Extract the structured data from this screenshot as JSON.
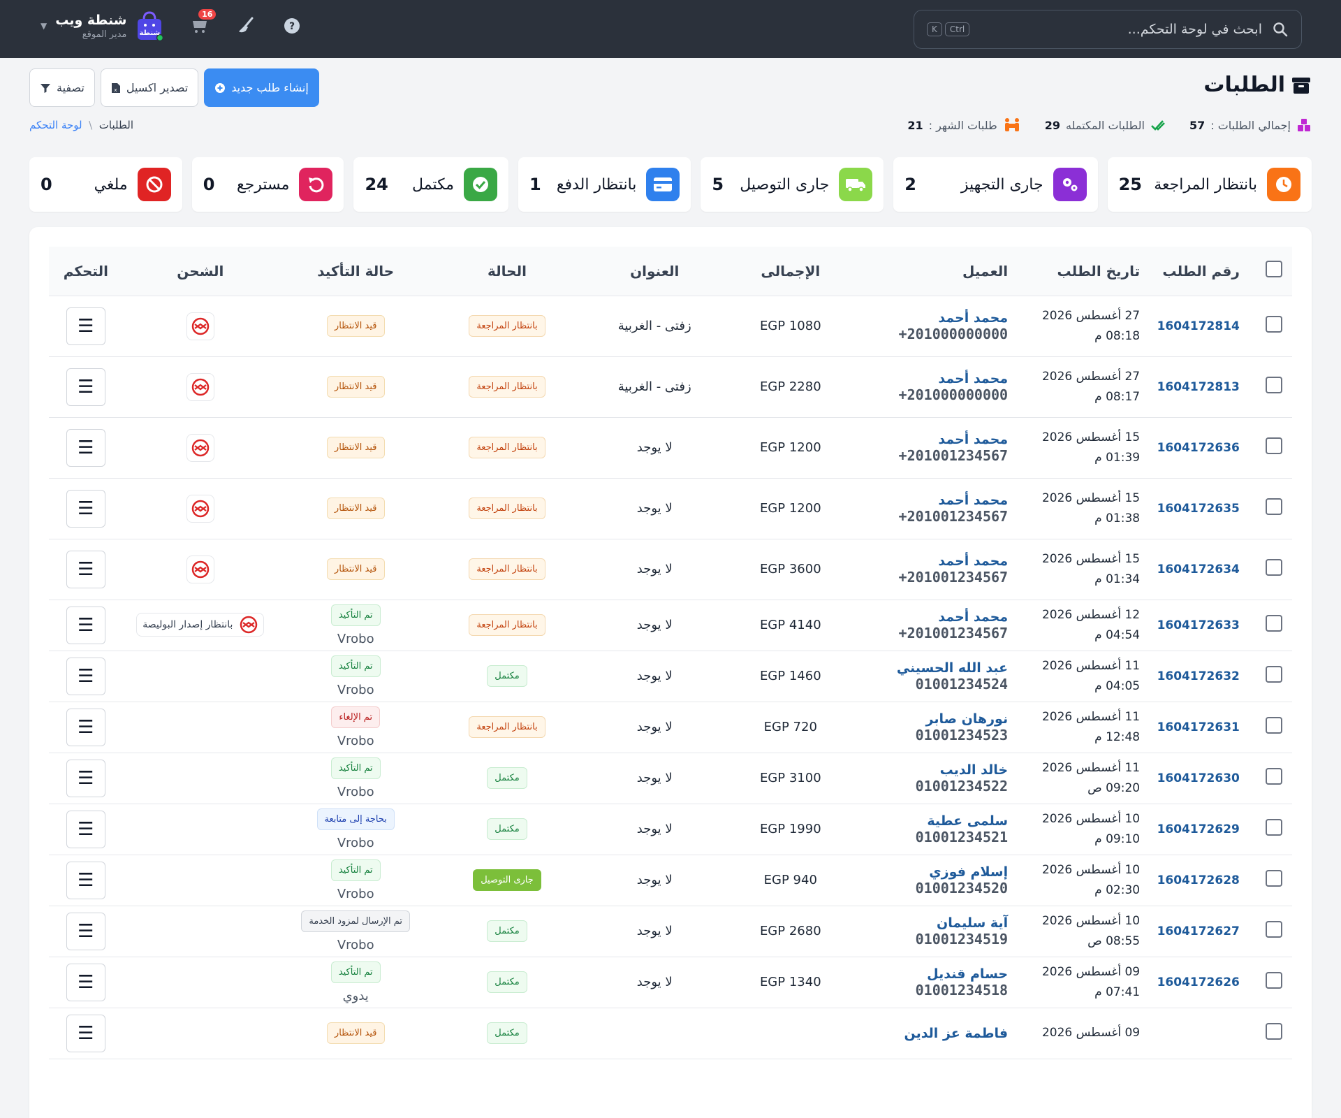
{
  "topbar": {
    "search_placeholder": "ابحث في لوحة التحكم...",
    "kbd_ctrl": "Ctrl",
    "kbd_k": "K",
    "brand_name": "شنطة ويب",
    "brand_role": "مدير الموقع",
    "logo_text": "شنطة",
    "notif_count": "16"
  },
  "header": {
    "title": "الطلبات",
    "btn_new": "إنشاء طلب جديد",
    "btn_export": "تصدير اكسيل",
    "btn_filter": "تصفية",
    "stats": [
      {
        "label": "إجمالي الطلبات :",
        "value": "57"
      },
      {
        "label": "الطلبات المكتمله",
        "value": "29"
      },
      {
        "label": "طلبات الشهر :",
        "value": "21"
      }
    ],
    "crumb_home": "لوحة التحكم",
    "crumb_sep": "\\",
    "crumb_current": "الطلبات"
  },
  "cards": [
    {
      "label": "بانتظار المراجعة",
      "value": "25",
      "color": "#f97316",
      "icon": "clock-icon"
    },
    {
      "label": "جارى التجهيز",
      "value": "2",
      "color": "#8b2fd6",
      "icon": "gears-icon"
    },
    {
      "label": "جارى التوصيل",
      "value": "5",
      "color": "#8bd84a",
      "icon": "truck-icon"
    },
    {
      "label": "بانتظار الدفع",
      "value": "1",
      "color": "#2f80ed",
      "icon": "card-icon"
    },
    {
      "label": "مكتمل",
      "value": "24",
      "color": "#3aa845",
      "icon": "check-circle-icon"
    },
    {
      "label": "مسترجع",
      "value": "0",
      "color": "#e0245e",
      "icon": "undo-icon"
    },
    {
      "label": "ملغي",
      "value": "0",
      "color": "#e02424",
      "icon": "ban-icon"
    }
  ],
  "table": {
    "headers": [
      "رقم الطلب",
      "تاريخ الطلب",
      "العميل",
      "الإجمالى",
      "العنوان",
      "الحالة",
      "حالة التأكيد",
      "الشحن",
      "التحكم"
    ],
    "rows": [
      {
        "id": "1604172814",
        "date": "27 أغسطس 2026",
        "time": "08:18 م",
        "name": "محمد أحمد",
        "phone": "+201000000000",
        "total": "EGP 1080",
        "addr": "زفتى - الغربية",
        "status": "بانتظار المراجعة",
        "st": "p-rev",
        "confirm": "قيد الانتظار",
        "cf": "p-wait",
        "sub": "",
        "ship": "icon",
        "ship_text": ""
      },
      {
        "id": "1604172813",
        "date": "27 أغسطس 2026",
        "time": "08:17 م",
        "name": "محمد أحمد",
        "phone": "+201000000000",
        "total": "EGP 2280",
        "addr": "زفتى - الغربية",
        "status": "بانتظار المراجعة",
        "st": "p-rev",
        "confirm": "قيد الانتظار",
        "cf": "p-wait",
        "sub": "",
        "ship": "icon",
        "ship_text": ""
      },
      {
        "id": "1604172636",
        "date": "15 أغسطس 2026",
        "time": "01:39 م",
        "name": "محمد أحمد",
        "phone": "+201001234567",
        "total": "EGP 1200",
        "addr": "لا يوجد",
        "status": "بانتظار المراجعة",
        "st": "p-rev",
        "confirm": "قيد الانتظار",
        "cf": "p-wait",
        "sub": "",
        "ship": "icon",
        "ship_text": ""
      },
      {
        "id": "1604172635",
        "date": "15 أغسطس 2026",
        "time": "01:38 م",
        "name": "محمد أحمد",
        "phone": "+201001234567",
        "total": "EGP 1200",
        "addr": "لا يوجد",
        "status": "بانتظار المراجعة",
        "st": "p-rev",
        "confirm": "قيد الانتظار",
        "cf": "p-wait",
        "sub": "",
        "ship": "icon",
        "ship_text": ""
      },
      {
        "id": "1604172634",
        "date": "15 أغسطس 2026",
        "time": "01:34 م",
        "name": "محمد أحمد",
        "phone": "+201001234567",
        "total": "EGP 3600",
        "addr": "لا يوجد",
        "status": "بانتظار المراجعة",
        "st": "p-rev",
        "confirm": "قيد الانتظار",
        "cf": "p-wait",
        "sub": "",
        "ship": "icon",
        "ship_text": ""
      },
      {
        "id": "1604172633",
        "date": "12 أغسطس 2026",
        "time": "04:54 م",
        "name": "محمد أحمد",
        "phone": "+201001234567",
        "total": "EGP 4140",
        "addr": "لا يوجد",
        "status": "بانتظار المراجعة",
        "st": "p-rev",
        "confirm": "تم التأكيد",
        "cf": "p-ok",
        "sub": "Vrobo",
        "ship": "wide",
        "ship_text": "بانتظار إصدار البوليصة"
      },
      {
        "id": "1604172632",
        "date": "11 أغسطس 2026",
        "time": "04:05 م",
        "name": "عبد الله الحسيني",
        "phone": "01001234524",
        "total": "EGP 1460",
        "addr": "لا يوجد",
        "status": "مكتمل",
        "st": "p-done",
        "confirm": "تم التأكيد",
        "cf": "p-ok",
        "sub": "Vrobo",
        "ship": "",
        "ship_text": ""
      },
      {
        "id": "1604172631",
        "date": "11 أغسطس 2026",
        "time": "12:48 م",
        "name": "نورهان صابر",
        "phone": "01001234523",
        "total": "EGP 720",
        "addr": "لا يوجد",
        "status": "بانتظار المراجعة",
        "st": "p-rev",
        "confirm": "تم الإلغاء",
        "cf": "p-can",
        "sub": "Vrobo",
        "ship": "",
        "ship_text": ""
      },
      {
        "id": "1604172630",
        "date": "11 أغسطس 2026",
        "time": "09:20 ص",
        "name": "خالد الديب",
        "phone": "01001234522",
        "total": "EGP 3100",
        "addr": "لا يوجد",
        "status": "مكتمل",
        "st": "p-done",
        "confirm": "تم التأكيد",
        "cf": "p-ok",
        "sub": "Vrobo",
        "ship": "",
        "ship_text": ""
      },
      {
        "id": "1604172629",
        "date": "10 أغسطس 2026",
        "time": "09:10 م",
        "name": "سلمى عطية",
        "phone": "01001234521",
        "total": "EGP 1990",
        "addr": "لا يوجد",
        "status": "مكتمل",
        "st": "p-done",
        "confirm": "بحاجة إلى متابعة",
        "cf": "p-fol",
        "sub": "Vrobo",
        "ship": "",
        "ship_text": ""
      },
      {
        "id": "1604172628",
        "date": "10 أغسطس 2026",
        "time": "02:30 م",
        "name": "إسلام فوزي",
        "phone": "01001234520",
        "total": "EGP 940",
        "addr": "لا يوجد",
        "status": "جارى التوصيل",
        "st": "p-del",
        "confirm": "تم التأكيد",
        "cf": "p-ok",
        "sub": "Vrobo",
        "ship": "",
        "ship_text": ""
      },
      {
        "id": "1604172627",
        "date": "10 أغسطس 2026",
        "time": "08:55 ص",
        "name": "آية سليمان",
        "phone": "01001234519",
        "total": "EGP 2680",
        "addr": "لا يوجد",
        "status": "مكتمل",
        "st": "p-done",
        "confirm": "تم الإرسال لمزود الخدمة",
        "cf": "p-snt",
        "sub": "Vrobo",
        "ship": "",
        "ship_text": ""
      },
      {
        "id": "1604172626",
        "date": "09 أغسطس 2026",
        "time": "07:41 م",
        "name": "حسام قنديل",
        "phone": "01001234518",
        "total": "EGP 1340",
        "addr": "لا يوجد",
        "status": "مكتمل",
        "st": "p-done",
        "confirm": "تم التأكيد",
        "cf": "p-ok",
        "sub": "يدوي",
        "ship": "",
        "ship_text": ""
      },
      {
        "id": "",
        "date": "09 أغسطس 2026",
        "time": "",
        "name": "فاطمة عز الدين",
        "phone": "",
        "total": "",
        "addr": "",
        "status": "مكتمل",
        "st": "p-done",
        "confirm": "قيد الانتظار",
        "cf": "p-wait",
        "sub": "",
        "ship": "",
        "ship_text": ""
      }
    ]
  }
}
